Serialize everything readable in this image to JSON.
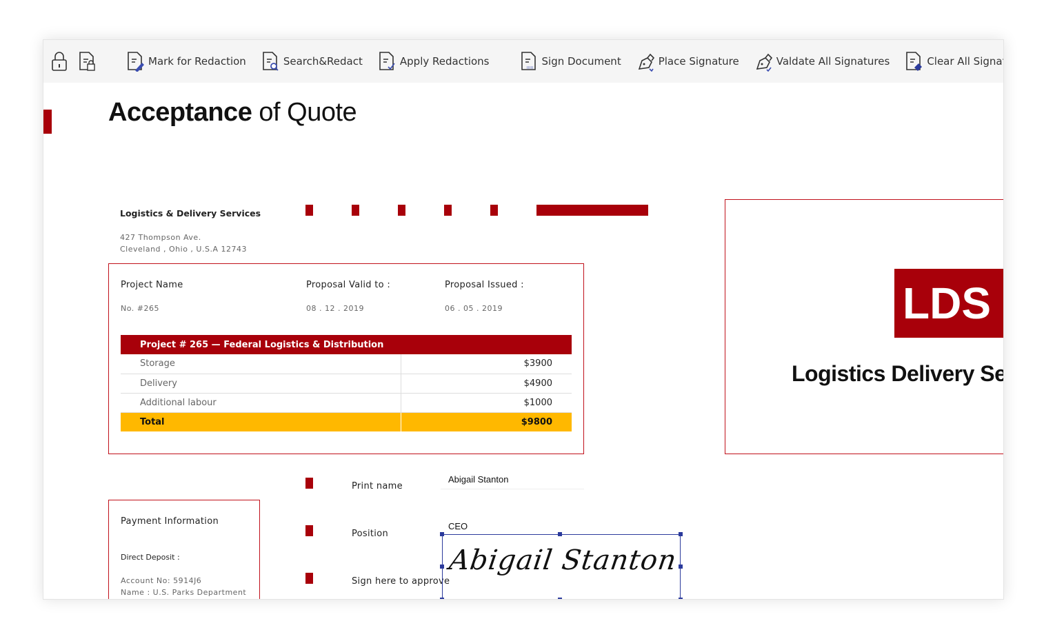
{
  "toolbar": {
    "lock_label": "",
    "items": [
      {
        "label": "Mark for Redaction",
        "icon": "doc-pen-icon"
      },
      {
        "label": "Search&Redact",
        "icon": "doc-search-icon"
      },
      {
        "label": "Apply Redactions",
        "icon": "doc-check-icon"
      },
      {
        "label": "Sign Document",
        "icon": "doc-sign-icon"
      },
      {
        "label": "Place Signature",
        "icon": "pen-nib-icon"
      },
      {
        "label": "Valdate All Signatures",
        "icon": "pen-nib-check-icon"
      },
      {
        "label": "Clear All Signatures",
        "icon": "doc-eraser-icon"
      }
    ]
  },
  "doc": {
    "title_bold": "Acceptance",
    "title_rest": " of Quote",
    "company": "Logistics & Delivery Services",
    "address1": "427 Thompson Ave.",
    "address2": "Cleveland , Ohio , U.S.A 12743",
    "project_name_label": "Project Name",
    "project_name": "No. #265",
    "valid_label": "Proposal Valid to :",
    "valid": "08 . 12 . 2019",
    "issued_label": "Proposal Issued :",
    "issued": "06 . 05 . 2019",
    "table_header": "Project # 265 — Federal Logistics & Distribution",
    "rows": [
      {
        "item": "Storage",
        "amount": "$3900"
      },
      {
        "item": "Delivery",
        "amount": "$4900"
      },
      {
        "item": "Additional labour",
        "amount": "$1000"
      }
    ],
    "total_label": "Total",
    "total": "$9800",
    "logo_text": "LDS",
    "logo_company": "Logistics Delivery Services",
    "print_name_label": "Print name",
    "print_name": "Abigail Stanton",
    "position_label": "Position",
    "position": "CEO",
    "sign_label": "Sign here to approve",
    "signature": "Abigail Stanton",
    "payment_title": "Payment Information",
    "deposit_label": "Direct Deposit :",
    "account": "Account No: 5914J6",
    "name": "Name :  U.S. Parks Department"
  },
  "colors": {
    "brand": "#a8000a",
    "total": "#ffb800",
    "selection": "#2b3a9c"
  }
}
